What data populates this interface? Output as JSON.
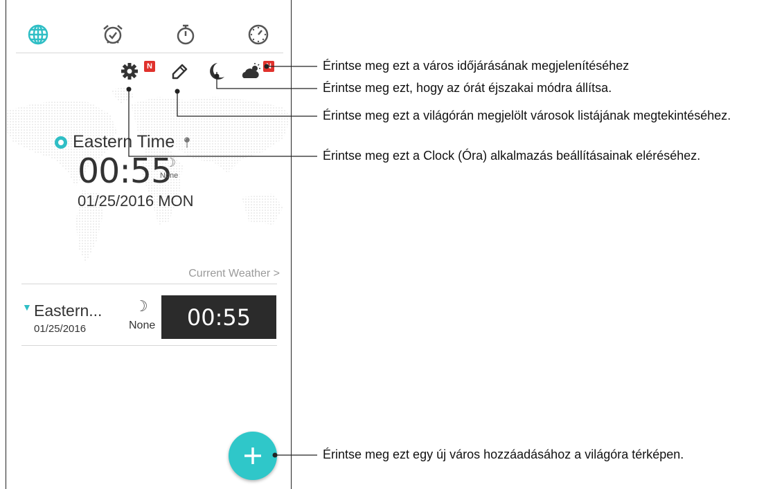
{
  "tabs": [
    {
      "icon": "world-clock-icon",
      "label": ""
    },
    {
      "icon": "alarm-icon",
      "label": ""
    },
    {
      "icon": "stopwatch-icon",
      "label": ""
    },
    {
      "icon": "timer-icon",
      "label": ""
    }
  ],
  "toolbar": {
    "settings_badge": "N",
    "weather_badge": "N"
  },
  "main": {
    "timezone_name": "Eastern Time",
    "time": "00:55",
    "dst_label": "None",
    "date": "01/25/2016 MON",
    "weather_link": "Current Weather >"
  },
  "city_list": [
    {
      "name": "Eastern...",
      "date": "01/25/2016",
      "dst": "None",
      "time": "00:55"
    }
  ],
  "fab": {
    "icon": "plus-icon"
  },
  "callouts": {
    "weather": "Érintse meg ezt a város időjárásának megjelenítéséhez",
    "night_mode": "Érintse meg ezt, hogy az órát éjszakai módra állítsa.",
    "edit_list": "Érintse meg ezt a világórán megjelölt városok listájának megtekintéséhez.",
    "settings": "Érintse meg ezt a Clock (Óra) alkalmazás beállításainak eléréséhez.",
    "add_city": "Érintse meg ezt egy új város hozzáadásához a világóra térképen."
  },
  "colors": {
    "accent": "#2fbec5",
    "badge": "#e0322d",
    "clock_tile": "#2b2b2b"
  }
}
